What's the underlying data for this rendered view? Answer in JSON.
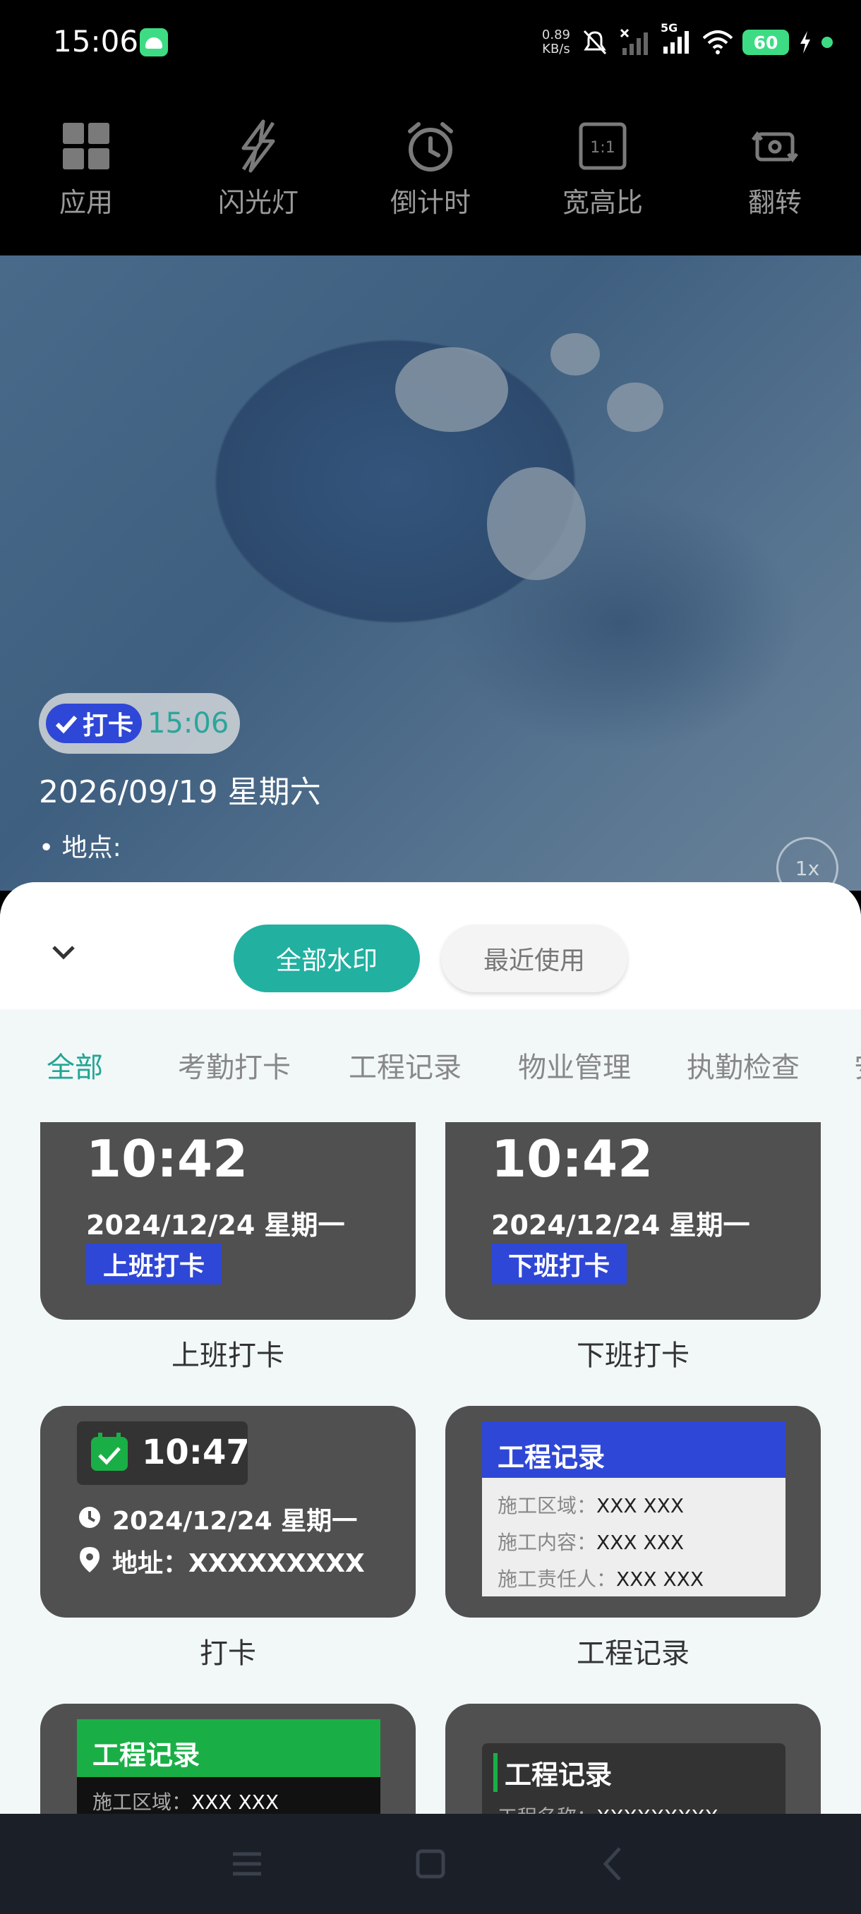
{
  "status_bar": {
    "time": "15:06",
    "net_speed_value": "0.89",
    "net_speed_unit": "KB/s",
    "signal_label": "5G",
    "battery": "60"
  },
  "toolbar": [
    {
      "label": "应用",
      "icon": "apps-grid-icon"
    },
    {
      "label": "闪光灯",
      "icon": "flash-off-icon"
    },
    {
      "label": "倒计时",
      "icon": "timer-icon"
    },
    {
      "label": "宽高比",
      "icon": "aspect-ratio-icon",
      "badge": "1:1"
    },
    {
      "label": "翻转",
      "icon": "flip-camera-icon"
    }
  ],
  "preview": {
    "watermark_tag": "打卡",
    "watermark_time": "15:06",
    "watermark_date": "2026/09/19 星期六",
    "watermark_location": "• 地点:",
    "zoom_label": "1x"
  },
  "sheet": {
    "tab_all_label": "全部水印",
    "tab_recent_label": "最近使用",
    "categories": [
      "全部",
      "考勤打卡",
      "工程记录",
      "物业管理",
      "执勤检查",
      "安"
    ],
    "active_category": "全部"
  },
  "templates": [
    {
      "caption": "上班打卡",
      "time": "10:42",
      "date": "2024/12/24 星期一",
      "tag": "上班打卡"
    },
    {
      "caption": "下班打卡",
      "time": "10:42",
      "date": "2024/12/24 星期一",
      "tag": "下班打卡"
    },
    {
      "caption": "打卡",
      "time": "10:47",
      "date": "2024/12/24 星期一",
      "address": "地址：XXXXXXXXX"
    },
    {
      "caption": "工程记录",
      "header": "工程记录",
      "rows": [
        {
          "k": "施工区域：",
          "v": "XXX XXX"
        },
        {
          "k": "施工内容：",
          "v": "XXX XXX"
        },
        {
          "k": "施工责任人：",
          "v": "XXX XXX"
        }
      ]
    },
    {
      "header": "工程记录",
      "rows": [
        {
          "k": "施工区域：",
          "v": "XXX XXX"
        }
      ]
    },
    {
      "header": "工程记录",
      "rows": [
        {
          "k": "工程名称：",
          "v": "XXXXXXXXX"
        }
      ]
    }
  ],
  "colors": {
    "accent": "#22b0a0",
    "blue_tag": "#2f47d6",
    "green_header": "#1aaf46"
  }
}
